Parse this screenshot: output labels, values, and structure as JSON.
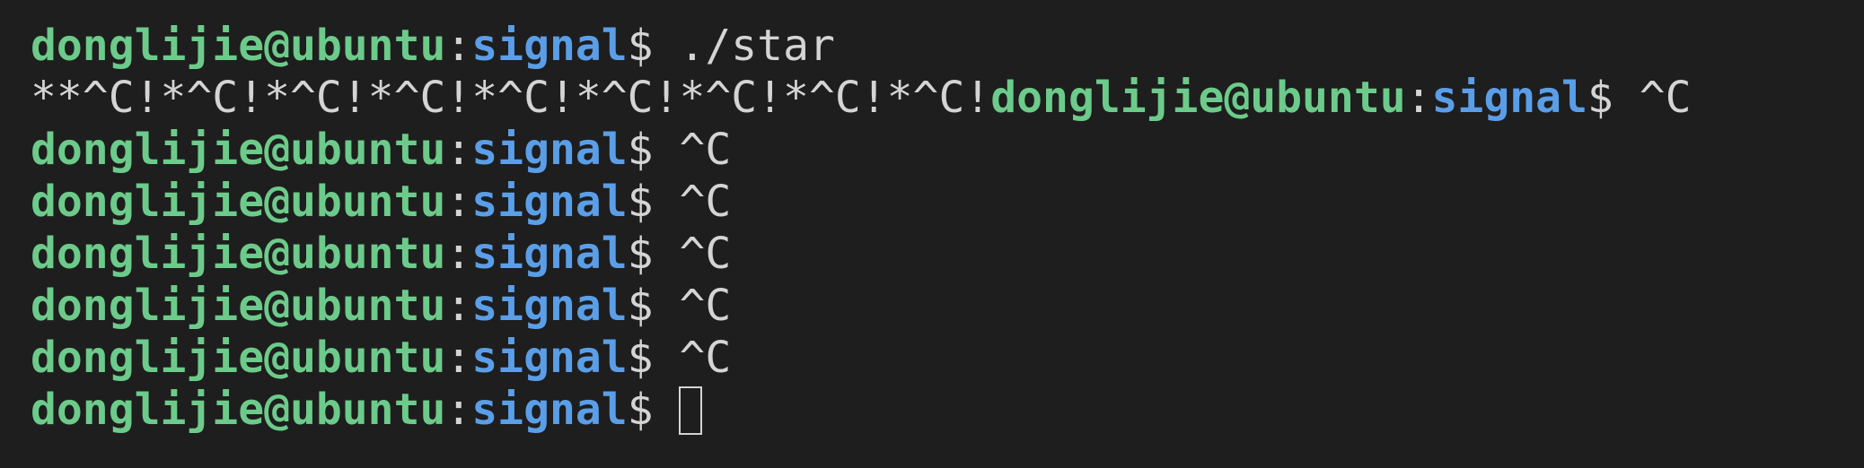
{
  "terminal": {
    "user_host": "donglijie@ubuntu",
    "colon": ":",
    "dir": "signal",
    "prompt_symbol": "$ ",
    "lines": [
      {
        "prefix": "",
        "command": "./star"
      },
      {
        "prefix": "**^C!*^C!*^C!*^C!*^C!*^C!*^C!*^C!*^C!",
        "command": "^C"
      },
      {
        "prefix": "",
        "command": "^C"
      },
      {
        "prefix": "",
        "command": "^C"
      },
      {
        "prefix": "",
        "command": "^C"
      },
      {
        "prefix": "",
        "command": "^C"
      },
      {
        "prefix": "",
        "command": "^C"
      },
      {
        "prefix": "",
        "command": ""
      }
    ],
    "colors": {
      "background": "#1e1e1e",
      "user_host": "#6ccb8a",
      "directory": "#5b9ee8",
      "text": "#d4d4d4"
    }
  }
}
